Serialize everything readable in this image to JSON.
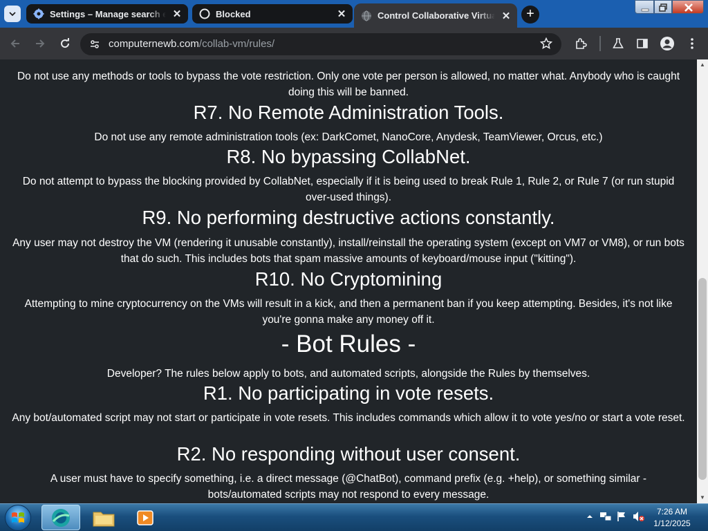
{
  "browser": {
    "tabs": [
      {
        "title": "Settings – Manage search engi",
        "favicon": "settings-gear-icon",
        "active": false
      },
      {
        "title": "Blocked",
        "favicon": "github-icon",
        "active": false
      },
      {
        "title": "Control Collaborative Virtual M",
        "favicon": "globe-icon",
        "active": true
      }
    ],
    "address_bar": {
      "domain": "computernewb.com",
      "path": "/collab-vm/rules/"
    },
    "accent_color": "#1b5fb0"
  },
  "page": {
    "sections": {
      "r6_text": "Do not use any methods or tools to bypass the vote restriction. Only one vote per person is allowed, no matter what. Anybody who is caught doing this will be banned.",
      "r7_heading": "R7. No Remote Administration Tools.",
      "r7_text": "Do not use any remote administration tools (ex: DarkComet, NanoCore, Anydesk, TeamViewer, Orcus, etc.)",
      "r8_heading": "R8. No bypassing CollabNet.",
      "r8_text": "Do not attempt to bypass the blocking provided by CollabNet, especially if it is being used to break Rule 1, Rule 2, or Rule 7 (or run stupid over-used things).",
      "r9_heading": "R9. No performing destructive actions constantly.",
      "r9_text": "Any user may not destroy the VM (rendering it unusable constantly), install/reinstall the operating system (except on VM7 or VM8), or run bots that do such. This includes bots that spam massive amounts of keyboard/mouse input (\"kitting\").",
      "r10_heading": "R10. No Cryptomining",
      "r10_text": "Attempting to mine cryptocurrency on the VMs will result in a kick, and then a permanent ban if you keep attempting. Besides, it's not like you're gonna make any money off it.",
      "bot_rules_heading": "- Bot Rules -",
      "bot_rules_intro": "Developer? The rules below apply to bots, and automated scripts, alongside the Rules by themselves.",
      "b1_heading": "R1. No participating in vote resets.",
      "b1_text": "Any bot/automated script may not start or participate in vote resets. This includes commands which allow it to vote yes/no or start a vote reset.",
      "b2_heading": "R2. No responding without user consent.",
      "b2_text": "A user must have to specify something, i.e. a direct message (@ChatBot), command prefix (e.g. +help), or something similar - bots/automated scripts may not respond to every message."
    },
    "background_color": "#212529"
  },
  "taskbar": {
    "pinned": [
      "browser-icon",
      "explorer-folder-icon",
      "media-player-icon"
    ],
    "tray_icons": [
      "show-hidden-icons-arrow",
      "network-icon",
      "action-center-flag-icon",
      "volume-muted-icon"
    ],
    "clock": {
      "time": "7:26 AM",
      "date": "1/12/2025"
    }
  }
}
